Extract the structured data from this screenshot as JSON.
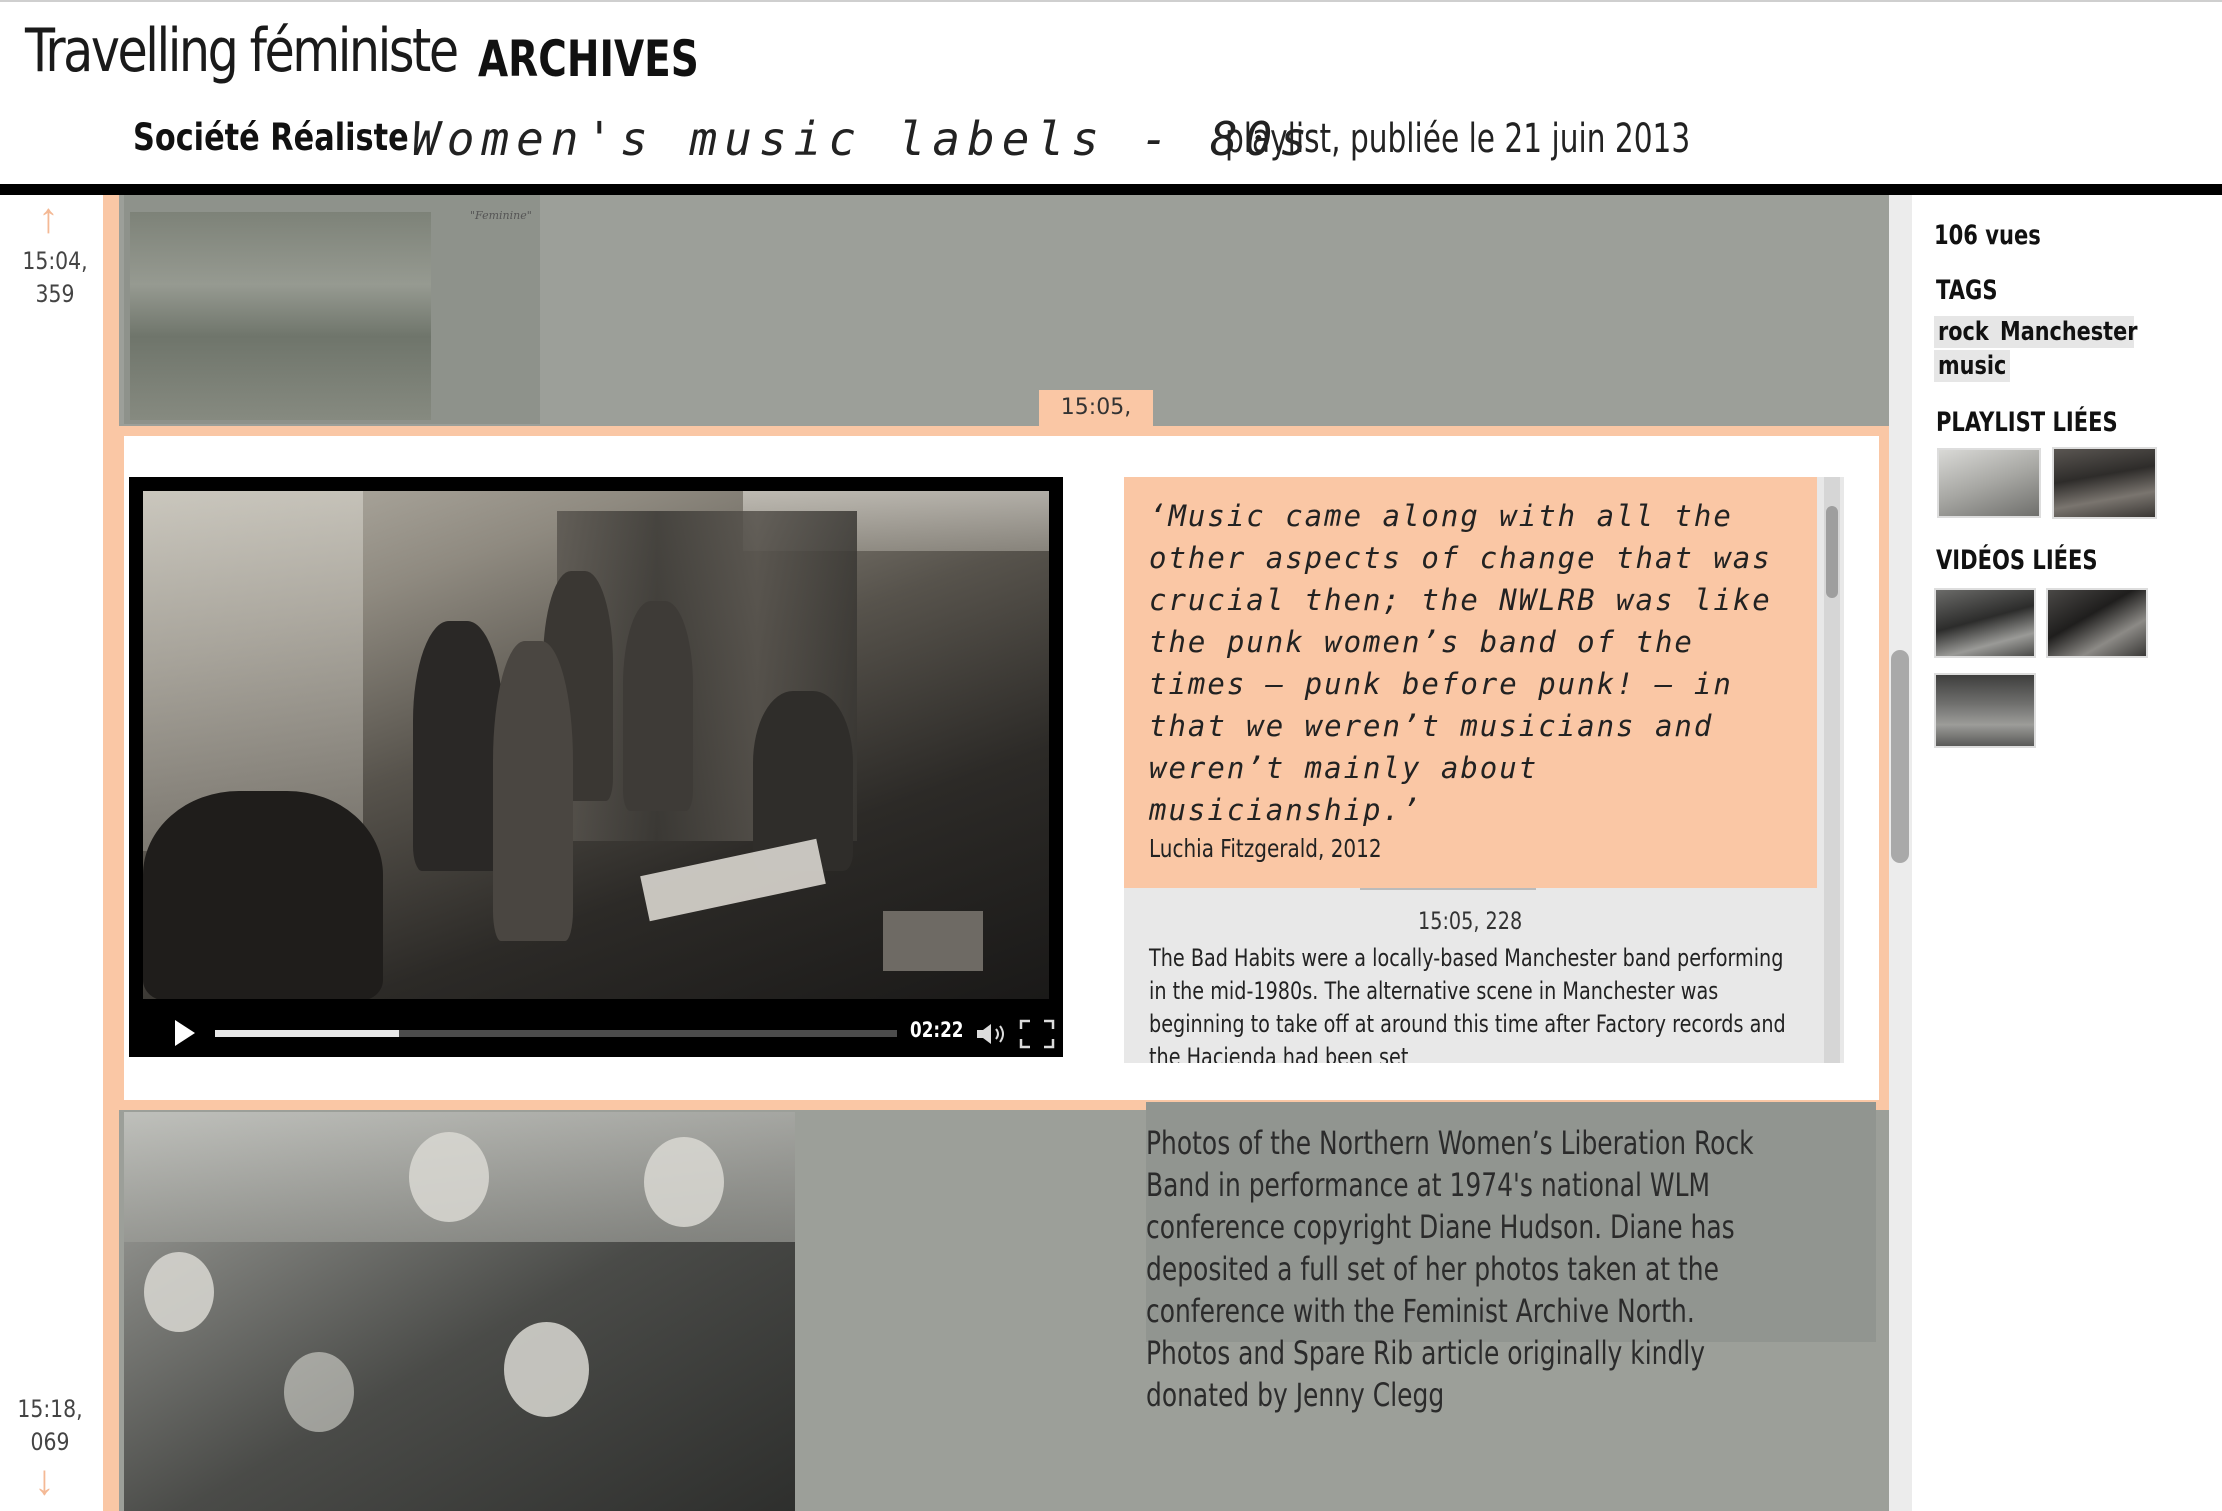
{
  "header": {
    "site_title": "Travelling féministe",
    "nav_archives": "ARCHIVES",
    "author": "Société Réaliste",
    "playlist_title": "Women's music labels - 80s",
    "publish_info": "playlist, publiée le 21 juin 2013"
  },
  "timeline": {
    "top_label_line1": "15:04,",
    "top_label_line2": "359",
    "bottom_label_line1": "15:18,",
    "bottom_label_line2": "069",
    "up_arrow": "↑",
    "down_arrow": "↓"
  },
  "previous_item": {
    "caption": "\"Feminine\""
  },
  "active_item": {
    "time_tab": "15:05, 228",
    "video": {
      "time_display": "02:22",
      "progress_played": 0.27,
      "progress_buffered": 0.27
    },
    "quote": "‘Music came along with all the other aspects of change that was crucial then; the NWLRB was like the punk women’s band of the times – punk before punk! – in that we weren’t musicians and weren’t mainly about musicianship.’",
    "quote_author": "Luchia Fitzgerald, 2012",
    "time_label": "15:05, 228",
    "description": "The Bad Habits were a locally-based Manchester band performing in the mid-1980s. The alternative scene in Manchester was beginning to take off at around this time after Factory records and the Hacienda had been set"
  },
  "next_item": {
    "description": "Photos of the Northern Women’s Liberation Rock Band in performance at 1974's national WLM conference copyright Diane Hudson. Diane has deposited a full set of her photos taken at the conference with the Feminist Archive North. Photos and Spare Rib article originally kindly donated by Jenny Clegg"
  },
  "sidebar": {
    "views": "106 vues",
    "tags_heading": "TAGS",
    "tags": [
      "rock",
      "Manchester",
      "music"
    ],
    "related_playlists_heading": "PLAYLIST LIÉES",
    "related_videos_heading": "VIDÉOS LIÉES"
  },
  "colors": {
    "accent": "#fac7a5",
    "content_bg": "#9c9f99",
    "header_rule": "#000000"
  },
  "icons": [
    "arrow-up-icon",
    "arrow-down-icon",
    "play-icon",
    "volume-icon",
    "fullscreen-icon"
  ]
}
